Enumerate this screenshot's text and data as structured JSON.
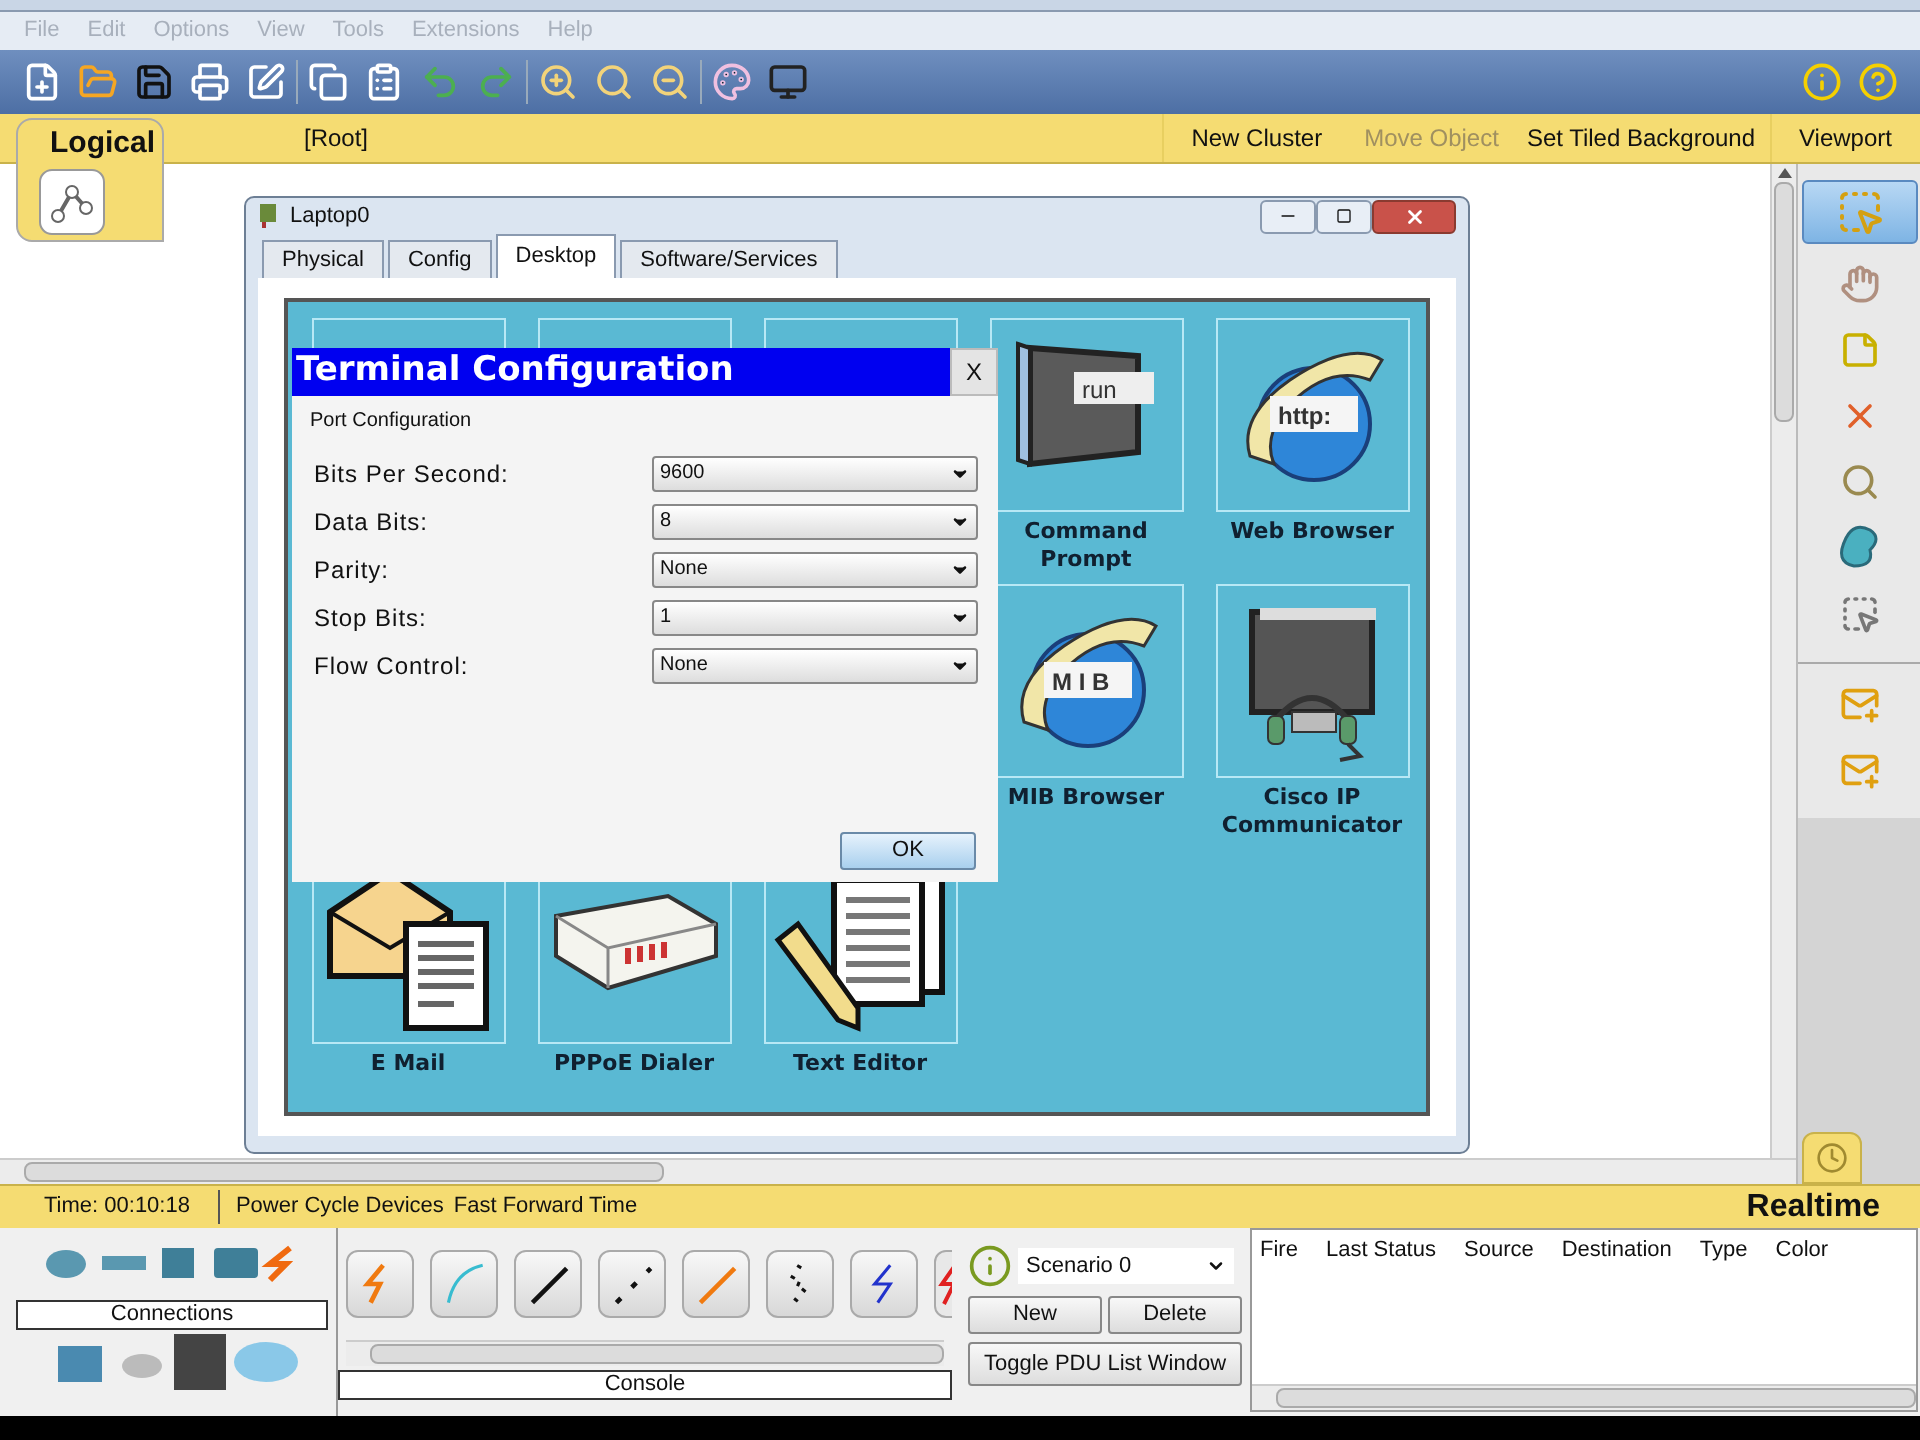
{
  "menu": [
    "File",
    "Edit",
    "Options",
    "View",
    "Tools",
    "Extensions",
    "Help"
  ],
  "workspace_bar": {
    "tab": "Logical",
    "path": "[Root]",
    "actions": [
      {
        "label": "New Cluster",
        "disabled": false
      },
      {
        "label": "Move Object",
        "disabled": true
      },
      {
        "label": "Set Tiled Background",
        "disabled": false
      },
      {
        "label": "Viewport",
        "disabled": false
      }
    ]
  },
  "device_window": {
    "title": "Laptop0",
    "tabs": [
      {
        "label": "Physical",
        "selected": false
      },
      {
        "label": "Config",
        "selected": false
      },
      {
        "label": "Desktop",
        "selected": true
      },
      {
        "label": "Software/Services",
        "selected": false
      }
    ],
    "app_rows": [
      [
        {
          "label": "Command Prompt",
          "kind": "terminal",
          "icon_text": "run"
        },
        {
          "label": "Web Browser",
          "kind": "globe",
          "icon_text": "http:"
        }
      ],
      [
        {
          "label": "MIB Browser",
          "kind": "globe",
          "icon_text": "M I B"
        },
        {
          "label": "Cisco IP Communicator",
          "kind": "phone"
        }
      ],
      [
        {
          "label": "E Mail",
          "kind": "mail"
        },
        {
          "label": "PPPoE Dialer",
          "kind": "modem"
        },
        {
          "label": "Text Editor",
          "kind": "editor"
        }
      ]
    ]
  },
  "terminal_dialog": {
    "title": "Terminal Configuration",
    "close": "X",
    "section": "Port Configuration",
    "fields": [
      {
        "label": "Bits Per Second:",
        "value": "9600"
      },
      {
        "label": "Data Bits:",
        "value": "8"
      },
      {
        "label": "Parity:",
        "value": "None"
      },
      {
        "label": "Stop Bits:",
        "value": "1"
      },
      {
        "label": "Flow Control:",
        "value": "None"
      }
    ],
    "ok": "OK"
  },
  "status_bar": {
    "time": "Time: 00:10:18",
    "actions": [
      "Power Cycle Devices",
      "Fast Forward Time"
    ],
    "mode": "Realtime"
  },
  "device_panel": {
    "category": "Connections"
  },
  "cable_panel": {
    "type": "Console"
  },
  "scenario": {
    "value": "Scenario 0",
    "buttons": [
      "New",
      "Delete"
    ],
    "toggle": "Toggle PDU List Window"
  },
  "pdu_table": {
    "columns": [
      "Fire",
      "Last Status",
      "Source",
      "Destination",
      "Type",
      "Color"
    ]
  }
}
